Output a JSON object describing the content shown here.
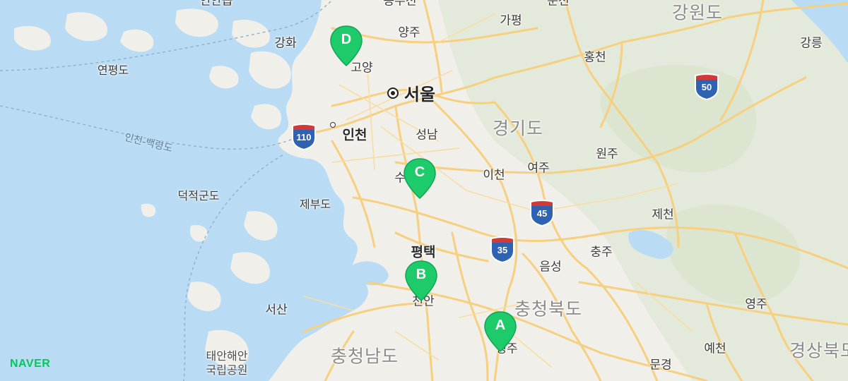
{
  "map": {
    "places": {
      "seoul": "서울",
      "incheon": "인천",
      "seongnam": "성남",
      "suwon": "수원",
      "goyang": "고양",
      "yangju": "양주",
      "gapyeong": "가평",
      "hongcheon": "홍천",
      "gangneung": "강릉",
      "ganghwa": "강화",
      "yeonpyeongdo": "연평도",
      "deokjeokgundo": "덕적군도",
      "jebudo": "제부도",
      "icheon": "이천",
      "yeoju": "여주",
      "wonju": "원주",
      "jecheon": "제천",
      "chungju": "충주",
      "eumseong": "음성",
      "pyeongtaek": "평택",
      "cheonan": "천안",
      "seosan": "서산",
      "cheongju": "청주",
      "yeongju": "영주",
      "yecheon": "예천",
      "mungyeong": "문경",
      "top_partial_1": "연안읍",
      "top_partial_2": "동두천",
      "top_partial_3": "춘천"
    },
    "regions": {
      "gangwon": "강원도",
      "gyeonggi": "경기도",
      "chungbuk": "충청북도",
      "chungnam": "충청남도",
      "gyeongbuk": "경상북도"
    },
    "sea_route": "인천-백령도",
    "park": {
      "line1": "태안해안",
      "line2": "국립공원"
    },
    "highways": [
      "110",
      "50",
      "45",
      "35"
    ],
    "markers": [
      "A",
      "B",
      "C",
      "D"
    ],
    "branding": "NAVER",
    "colors": {
      "water": "#b9dcf4",
      "land": "#f1efe9",
      "road": "#f6cf7f",
      "forest": "#e0e8d6",
      "marker": "#1ecb6b",
      "shield_blue": "#2f63b1",
      "shield_red": "#d23a3a",
      "brand": "#03c75a"
    }
  }
}
